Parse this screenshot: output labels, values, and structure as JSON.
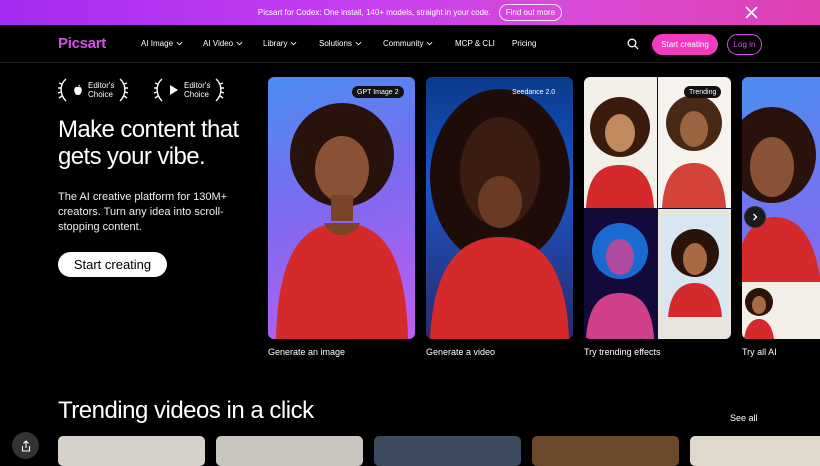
{
  "banner": {
    "text": "Picsart for Codex: One install, 140+ models, straight in your code.",
    "button": "Find out more"
  },
  "nav": {
    "logo": "Picsart",
    "items": [
      {
        "label": "AI Image",
        "dropdown": true
      },
      {
        "label": "AI Video",
        "dropdown": true
      },
      {
        "label": "Library",
        "dropdown": true
      },
      {
        "label": "Solutions",
        "dropdown": true
      },
      {
        "label": "Community",
        "dropdown": true
      },
      {
        "label": "MCP & CLI",
        "dropdown": false
      },
      {
        "label": "Pricing",
        "dropdown": false
      }
    ],
    "start_label": "Start creating",
    "login_label": "Log in"
  },
  "awards": [
    {
      "line1": "Editor's",
      "line2": "Choice",
      "store": "apple"
    },
    {
      "line1": "Editor's",
      "line2": "Choice",
      "store": "google-play"
    }
  ],
  "hero": {
    "title": "Make content that gets your vibe.",
    "subtitle": "The AI creative platform for 130M+ creators. Turn any idea into scroll-stopping content.",
    "cta": "Start creating"
  },
  "cards": [
    {
      "label": "Generate an image",
      "badge": "GPT Image 2"
    },
    {
      "label": "Generate a video",
      "badge": "Seedance 2.0"
    },
    {
      "label": "Try trending effects",
      "badge": "Trending"
    },
    {
      "label": "Try all AI",
      "badge": ""
    }
  ],
  "trending": {
    "title": "Trending videos in a click",
    "see_all": "See all"
  },
  "colors": {
    "accent": "#f23bc0",
    "logo": "#d44fe8",
    "card_red": "#d42a2c"
  }
}
